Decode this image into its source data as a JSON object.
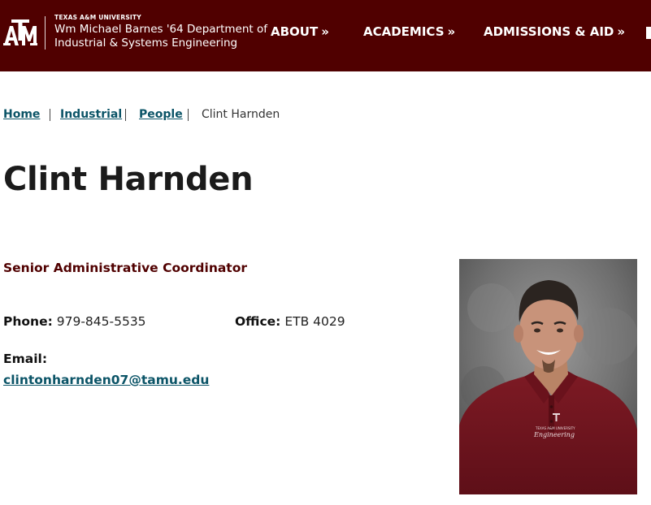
{
  "header": {
    "logo_alt": "Texas A&M logo",
    "university": "TEXAS A&M UNIVERSITY",
    "department_line1": "Wm Michael Barnes '64 Department of",
    "department_line2": "Industrial & Systems Engineering",
    "brand_color": "#500000",
    "nav": [
      {
        "label": "ABOUT",
        "chevron": "»"
      },
      {
        "label": "ACADEMICS",
        "chevron": "»"
      },
      {
        "label": "ADMISSIONS & AID",
        "chevron": "»"
      }
    ]
  },
  "breadcrumb": [
    {
      "label": "Home"
    },
    {
      "label": "Industrial"
    },
    {
      "label": "People"
    },
    {
      "label": "Clint Harnden"
    }
  ],
  "profile": {
    "name": "Clint Harnden",
    "title": "Senior Administrative Coordinator",
    "phone_label": "Phone:",
    "phone": "979-845-5535",
    "office_label": "Office:",
    "office": "ETB 4029",
    "email_label": "Email:",
    "email": "clintonharnden07@tamu.edu",
    "photo_alt": "Portrait photo of Clint Harnden",
    "shirt_text": "Engineering"
  },
  "colors": {
    "maroon": "#500000",
    "link": "#0b5467"
  }
}
